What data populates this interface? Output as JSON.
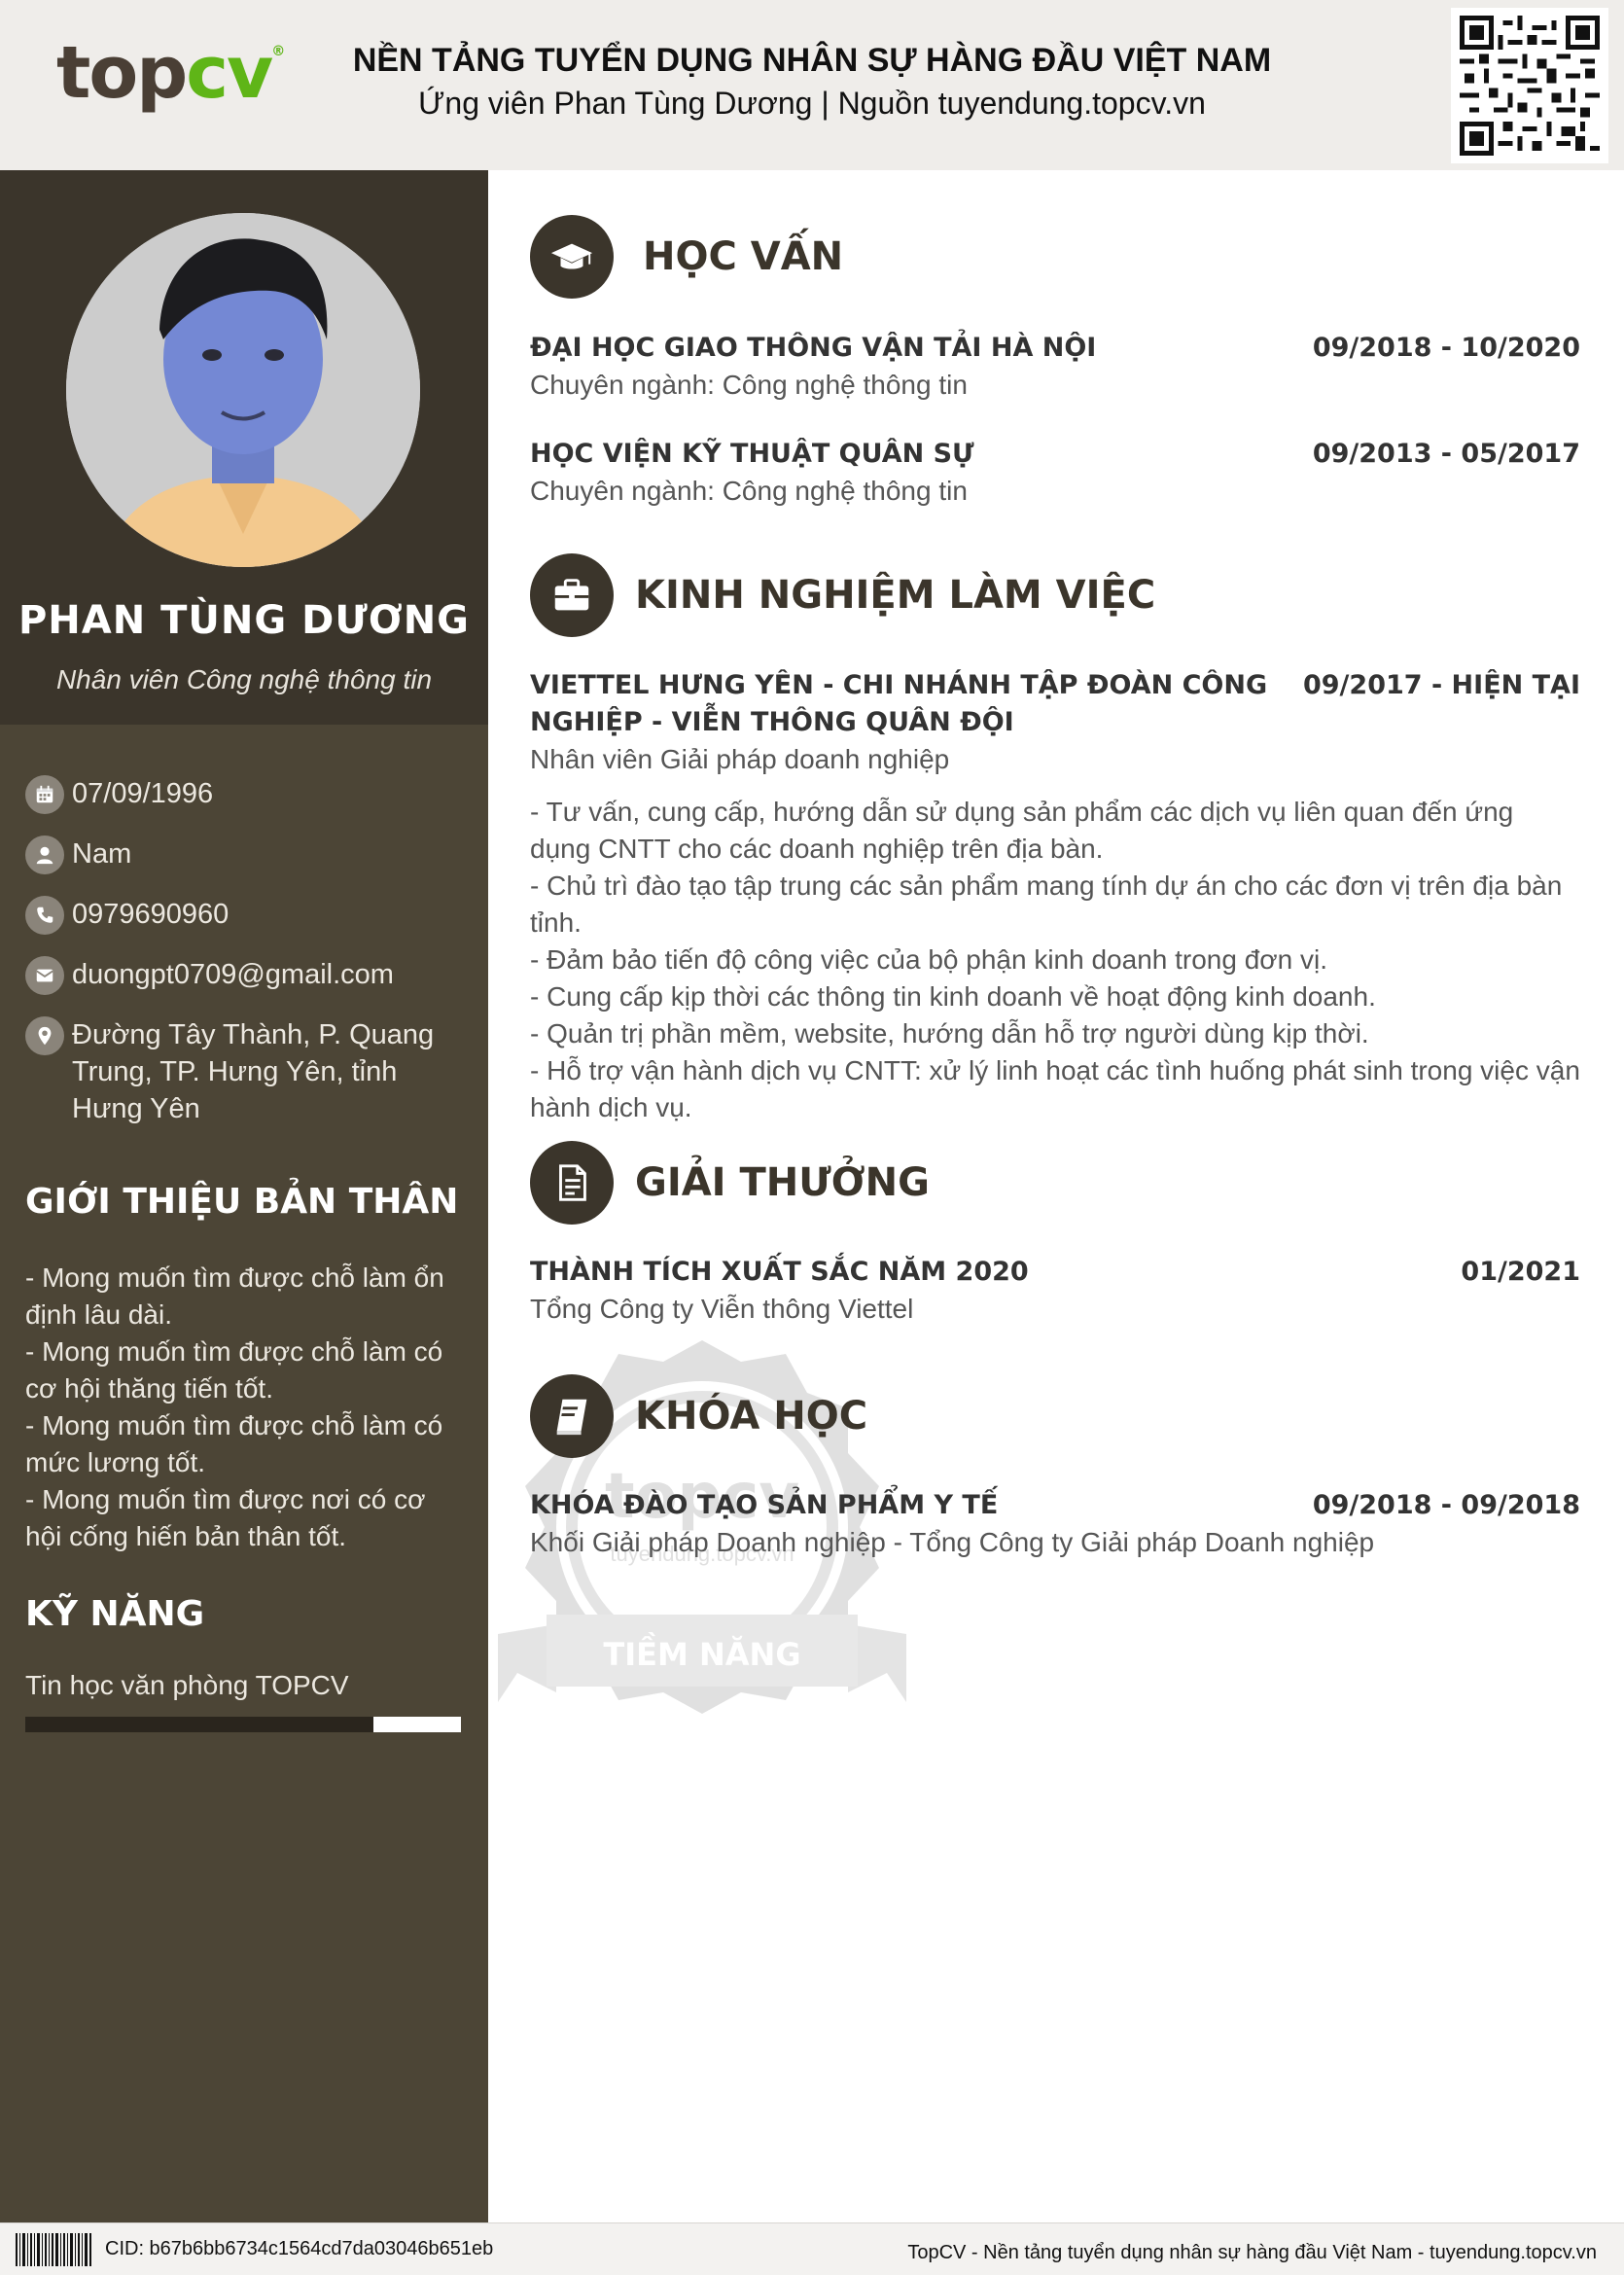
{
  "header": {
    "logo_top": "top",
    "logo_cv": "cv",
    "logo_reg": "®",
    "title": "NỀN TẢNG TUYỂN DỤNG NHÂN SỰ HÀNG ĐẦU VIỆT NAM",
    "subtitle": "Ứng viên Phan Tùng Dương | Nguồn tuyendung.topcv.vn"
  },
  "profile": {
    "name": "PHAN TÙNG DƯƠNG",
    "position": "Nhân viên Công nghệ thông tin"
  },
  "contact": {
    "dob": "07/09/1996",
    "gender": "Nam",
    "phone": "0979690960",
    "email": "duongpt0709@gmail.com",
    "address": "Đường Tây Thành, P. Quang Trung, TP. Hưng Yên, tỉnh Hưng Yên"
  },
  "about": {
    "heading": "GIỚI THIỆU BẢN THÂN",
    "lines": [
      "- Mong muốn tìm được chỗ làm ổn định lâu dài.",
      "- Mong muốn tìm được chỗ làm có cơ hội thăng tiến tốt.",
      "- Mong muốn tìm được chỗ làm có mức lương tốt.",
      "- Mong muốn tìm được nơi có cơ hội cống hiến bản thân tốt."
    ]
  },
  "skills": {
    "heading": "KỸ NĂNG",
    "items": [
      {
        "name": "Tin học văn phòng TOPCV",
        "level": 0.2
      }
    ]
  },
  "education": {
    "heading": "HỌC VẤN",
    "items": [
      {
        "school": "ĐẠI HỌC GIAO THÔNG VẬN TẢI HÀ NỘI",
        "date": "09/2018 - 10/2020",
        "major": "Chuyên ngành: Công nghệ thông tin"
      },
      {
        "school": "HỌC VIỆN KỸ THUẬT QUÂN SỰ",
        "date": "09/2013 - 05/2017",
        "major": "Chuyên ngành: Công nghệ thông tin"
      }
    ]
  },
  "experience": {
    "heading": "KINH NGHIỆM LÀM VIỆC",
    "items": [
      {
        "company": "VIETTEL HƯNG YÊN - CHI NHÁNH TẬP ĐOÀN CÔNG NGHIỆP - VIỄN THÔNG QUÂN ĐỘI",
        "date": "09/2017 - HIỆN TẠI",
        "role": "Nhân viên Giải pháp doanh nghiệp",
        "duties": [
          "- Tư vấn, cung cấp, hướng dẫn sử dụng sản phẩm các dịch vụ liên quan đến ứng dụng CNTT cho các doanh nghiệp trên địa bàn.",
          "- Chủ trì đào tạo tập trung các sản phẩm mang tính dự án cho các đơn vị trên địa bàn tỉnh.",
          "- Đảm bảo tiến độ công việc của bộ phận kinh doanh trong đơn vị.",
          "- Cung cấp kịp thời các thông tin kinh doanh về hoạt động kinh doanh.",
          "- Quản trị phần mềm, website, hướng dẫn hỗ trợ người dùng kịp thời.",
          "- Hỗ trợ vận hành dịch vụ CNTT: xử lý linh hoạt các tình huống phát sinh trong việc vận hành dịch vụ."
        ]
      }
    ]
  },
  "awards": {
    "heading": "GIẢI THƯỞNG",
    "items": [
      {
        "title": "THÀNH TÍCH XUẤT SẮC NĂM 2020",
        "date": "01/2021",
        "org": "Tổng Công ty Viễn thông Viettel"
      }
    ]
  },
  "courses": {
    "heading": "KHÓA HỌC",
    "items": [
      {
        "title": "KHÓA ĐÀO TẠO SẢN PHẨM Y TẾ",
        "date": "09/2018 - 09/2018",
        "org": "Khối Giải pháp Doanh nghiệp - Tổng Công ty Giải pháp Doanh nghiệp"
      }
    ]
  },
  "watermark": {
    "brand": "topcv",
    "url": "tuyendung.topcv.vn",
    "ribbon": "TIỀM NĂNG"
  },
  "footer": {
    "cid": "CID: b67b6bb6734c1564cd7da03046b651eb",
    "tagline": "TopCV - Nền tảng tuyển dụng nhân sự hàng đầu Việt Nam - tuyendung.topcv.vn"
  },
  "colors": {
    "sidebar_dark": "#3b352b",
    "sidebar": "#4c4536",
    "accent_green": "#5fb517"
  }
}
